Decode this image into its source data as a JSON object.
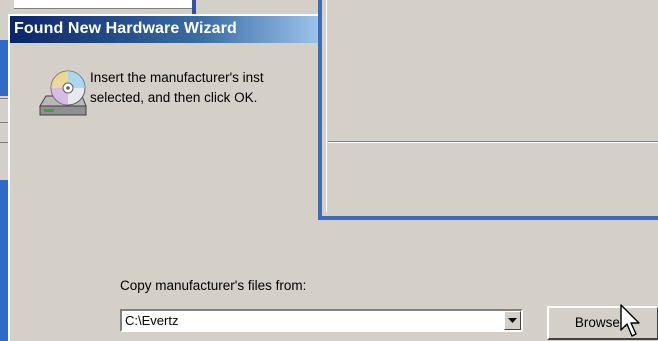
{
  "window": {
    "title": "Found New Hardware Wizard",
    "instruction_line1": "Insert the manufacturer's inst",
    "instruction_line2": "selected, and then click OK."
  },
  "copy_from": {
    "label": "Copy manufacturer's files from:",
    "path": "C:\\Evertz",
    "browse_label": "Browse..."
  },
  "icons": {
    "cd": "cd-drive-icon",
    "dropdown": "chevron-down-icon",
    "cursor": "mouse-pointer-icon"
  },
  "colors": {
    "title_start": "#0a246a",
    "title_end": "#a6caf0",
    "face": "#d4d0c8",
    "frame_blue": "#3d6bb8"
  }
}
